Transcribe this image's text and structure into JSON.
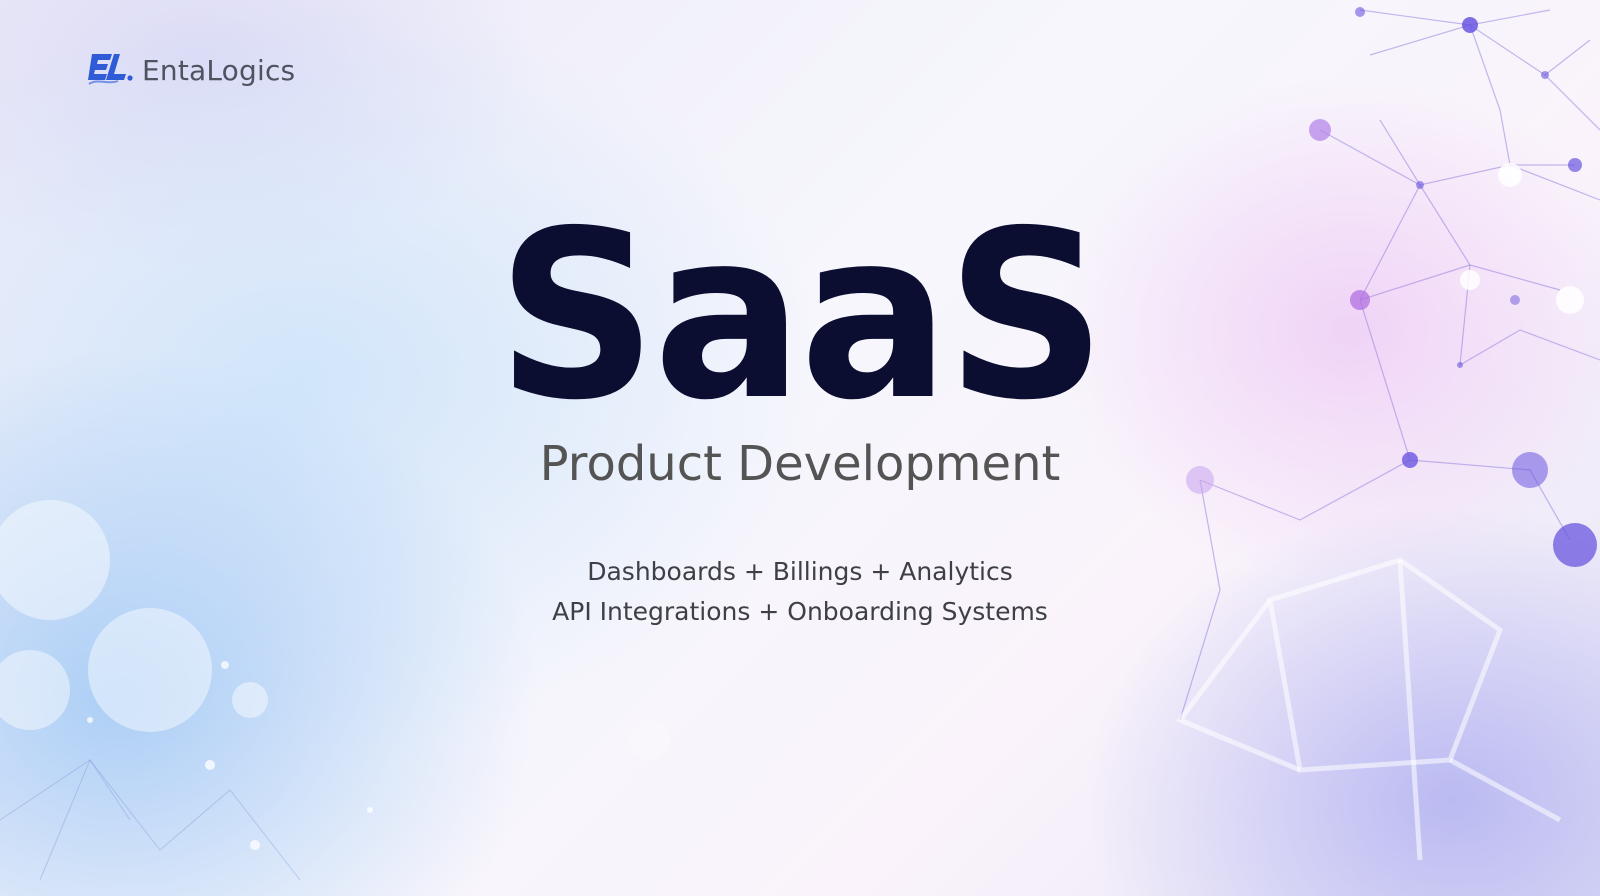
{
  "brand": {
    "name": "EntaLogics",
    "mark_color": "#2f5bd6",
    "icon": "entalogics-logo-icon"
  },
  "hero": {
    "title": "SaaS",
    "subtitle": "Product Development"
  },
  "features": {
    "line1": "Dashboards + Billings + Analytics",
    "line2": "API Integrations + Onboarding Systems"
  },
  "colors": {
    "title": "#0b0e30",
    "subtitle": "#545454",
    "body_text": "#3e4046",
    "network_accent": "#6a55e0"
  }
}
